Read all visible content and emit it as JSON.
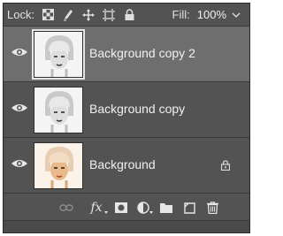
{
  "lockbar": {
    "lock_label": "Lock:",
    "fill_label": "Fill:",
    "fill_value": "100%",
    "icons": [
      "lock-transparent-pixels-icon",
      "lock-image-pixels-icon",
      "lock-position-icon",
      "lock-artboard-icon",
      "lock-all-icon"
    ]
  },
  "layers": [
    {
      "name": "Background copy 2",
      "selected": true,
      "visible": true,
      "locked": false,
      "thumbnail": "portrait-grayscale"
    },
    {
      "name": "Background copy",
      "selected": false,
      "visible": true,
      "locked": false,
      "thumbnail": "portrait-grayscale"
    },
    {
      "name": "Background",
      "selected": false,
      "visible": true,
      "locked": true,
      "thumbnail": "portrait-color"
    }
  ],
  "toolbar": {
    "fx_label": "fx",
    "icons": [
      "link-layers-icon",
      "layer-style-icon",
      "layer-mask-icon",
      "adjustment-layer-icon",
      "group-folder-icon",
      "new-layer-icon",
      "trash-icon"
    ]
  },
  "colors": {
    "panel_bg": "#535353",
    "selected_row_bg": "#6e6e6e",
    "text": "#f0f0f0",
    "divider": "#3c3c3c"
  }
}
